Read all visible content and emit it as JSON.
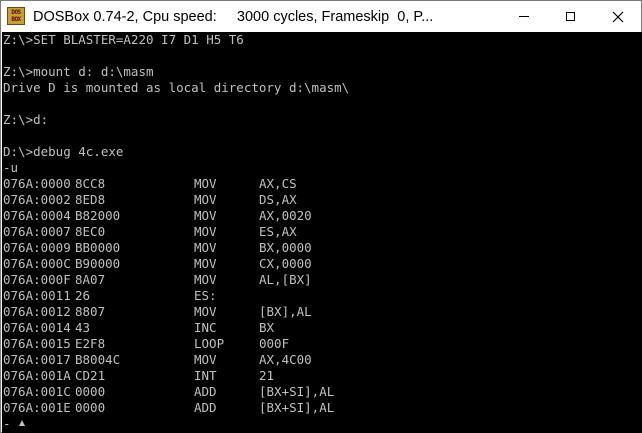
{
  "window": {
    "title": "DOSBox 0.74-2, Cpu speed:     3000 cycles, Frameskip  0, P...",
    "icon_text_top": "DOS",
    "icon_text_bottom": "BOX",
    "controls": [
      "minimize-icon",
      "maximize-icon",
      "close-icon"
    ]
  },
  "console": {
    "lines": [
      "Z:\\>SET BLASTER=A220 I7 D1 H5 T6",
      "",
      "Z:\\>mount d: d:\\masm",
      "Drive D is mounted as local directory d:\\masm\\",
      "",
      "Z:\\>d:",
      "",
      "D:\\>debug 4c.exe",
      "-u"
    ],
    "disassembly": [
      {
        "addr": "076A:0000",
        "bytes": "8CC8",
        "mnemonic": "MOV",
        "operands": "AX,CS"
      },
      {
        "addr": "076A:0002",
        "bytes": "8ED8",
        "mnemonic": "MOV",
        "operands": "DS,AX"
      },
      {
        "addr": "076A:0004",
        "bytes": "B82000",
        "mnemonic": "MOV",
        "operands": "AX,0020"
      },
      {
        "addr": "076A:0007",
        "bytes": "8EC0",
        "mnemonic": "MOV",
        "operands": "ES,AX"
      },
      {
        "addr": "076A:0009",
        "bytes": "BB0000",
        "mnemonic": "MOV",
        "operands": "BX,0000"
      },
      {
        "addr": "076A:000C",
        "bytes": "B90000",
        "mnemonic": "MOV",
        "operands": "CX,0000"
      },
      {
        "addr": "076A:000F",
        "bytes": "8A07",
        "mnemonic": "MOV",
        "operands": "AL,[BX]"
      },
      {
        "addr": "076A:0011",
        "bytes": "26",
        "mnemonic": "ES:",
        "operands": ""
      },
      {
        "addr": "076A:0012",
        "bytes": "8807",
        "mnemonic": "MOV",
        "operands": "[BX],AL"
      },
      {
        "addr": "076A:0014",
        "bytes": "43",
        "mnemonic": "INC",
        "operands": "BX"
      },
      {
        "addr": "076A:0015",
        "bytes": "E2F8",
        "mnemonic": "LOOP",
        "operands": "000F"
      },
      {
        "addr": "076A:0017",
        "bytes": "B8004C",
        "mnemonic": "MOV",
        "operands": "AX,4C00"
      },
      {
        "addr": "076A:001A",
        "bytes": "CD21",
        "mnemonic": "INT",
        "operands": "21"
      },
      {
        "addr": "076A:001C",
        "bytes": "0000",
        "mnemonic": "ADD",
        "operands": "[BX+SI],AL"
      },
      {
        "addr": "076A:001E",
        "bytes": "0000",
        "mnemonic": "ADD",
        "operands": "[BX+SI],AL"
      }
    ],
    "prompt": "-"
  },
  "colors": {
    "console_bg": "#000000",
    "console_fg": "#c0c0c0",
    "titlebar_bg": "#ffffff"
  }
}
